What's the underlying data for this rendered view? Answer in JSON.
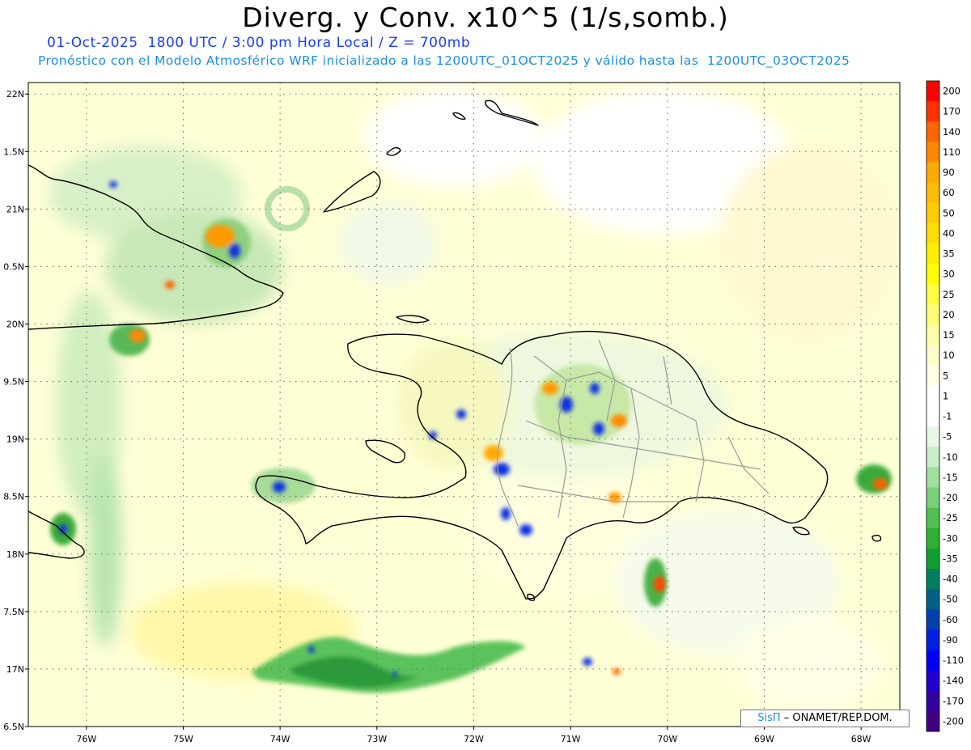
{
  "header": {
    "title": "Diverg. y Conv. x10^5 (1/s,somb.)",
    "subtitle_date": "01-Oct-2025  1800 UTC / 3:00 pm Hora Local / Z = 700mb",
    "subtitle_model": "Pronóstico con el Modelo Atmosférico WRF inicializado a las 1200UTC_01OCT2025 y válido hasta las  1200UTC_03OCT2025"
  },
  "map": {
    "lat_range": [
      16.5,
      22.1
    ],
    "lon_range": [
      -76.6,
      -67.6
    ],
    "lat_labels": [
      "22N",
      "1.5N",
      "21N",
      "0.5N",
      "20N",
      "9.5N",
      "19N",
      "8.5N",
      "18N",
      "7.5N",
      "17N",
      "6.5N"
    ],
    "lon_labels": [
      "76W",
      "75W",
      "74W",
      "73W",
      "72W",
      "71W",
      "70W",
      "69W",
      "68W"
    ],
    "grid": true
  },
  "colorbar": {
    "labels": [
      "200",
      "170",
      "140",
      "110",
      "90",
      "60",
      "50",
      "40",
      "35",
      "30",
      "25",
      "20",
      "15",
      "10",
      "5",
      "1",
      "-1",
      "-5",
      "-10",
      "-15",
      "-20",
      "-25",
      "-30",
      "-35",
      "-40",
      "-50",
      "-60",
      "-90",
      "-110",
      "-140",
      "-170",
      "-200"
    ],
    "colors": [
      "#ff0000",
      "#ff3300",
      "#ff6600",
      "#ff8800",
      "#ffaa00",
      "#ffbb00",
      "#ffcc00",
      "#ffdd00",
      "#ffee00",
      "#ffff00",
      "#ffff44",
      "#ffff77",
      "#ffffaa",
      "#ffffcc",
      "#ffffe6",
      "#ffffff",
      "#ffffff",
      "#e8f8e8",
      "#c8eec8",
      "#a0e0a0",
      "#78d078",
      "#50c050",
      "#30b030",
      "#10a030",
      "#008060",
      "#006088",
      "#0040b0",
      "#0020e0",
      "#0000ff",
      "#2000d0",
      "#3000a0",
      "#400080"
    ]
  },
  "credit": {
    "brand": "SisΠ",
    "org": "– ONAMET/REP.DOM."
  }
}
